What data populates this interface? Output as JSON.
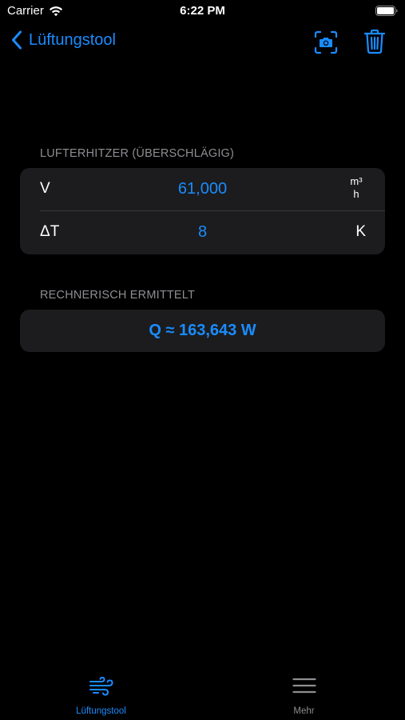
{
  "status_bar": {
    "carrier": "Carrier",
    "time": "6:22 PM"
  },
  "nav": {
    "back_label": "Lüftungstool",
    "icons": [
      "chevron-left-icon",
      "camera-viewfinder-icon",
      "trash-icon"
    ]
  },
  "section_heizung": {
    "header": "LUFTERHITZER (ÜBERSCHLÄGIG)",
    "rows": [
      {
        "label": "V",
        "value": "61,000",
        "unit_numerator": "m³",
        "unit_denominator": "h"
      },
      {
        "label": "ΔT",
        "value": "8",
        "unit": "K"
      }
    ]
  },
  "section_result": {
    "header": "RECHNERISCH ERMITTELT",
    "result": "Q ≈ 163,643 W"
  },
  "tab_bar": {
    "tabs": [
      {
        "label": "Lüftungstool",
        "icon": "wind-icon",
        "active": true
      },
      {
        "label": "Mehr",
        "icon": "menu-lines-icon",
        "active": false
      }
    ]
  },
  "colors": {
    "accent": "#1a8cff",
    "background": "#000000",
    "card": "#1c1c1e",
    "secondary_text": "#8e8e93",
    "inactive_tab": "#8e8e93"
  }
}
